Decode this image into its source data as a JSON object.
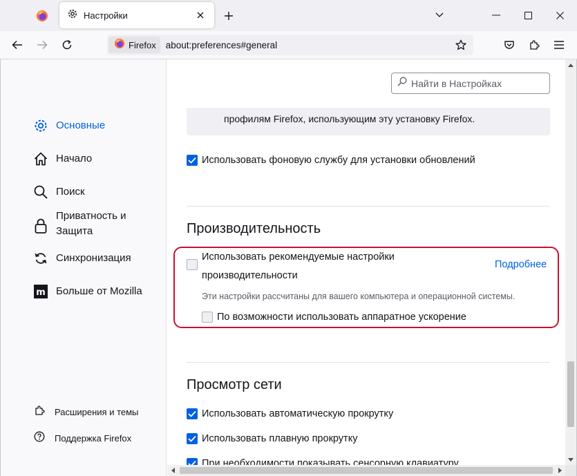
{
  "tab": {
    "title": "Настройки"
  },
  "urlbar": {
    "identity_label": "Firefox",
    "url": "about:preferences#general"
  },
  "search": {
    "placeholder": "Найти в Настройках"
  },
  "sidebar": {
    "categories": [
      {
        "label": "Основные",
        "icon": "gear-icon",
        "selected": true
      },
      {
        "label": "Начало",
        "icon": "home-icon"
      },
      {
        "label": "Поиск",
        "icon": "search-icon"
      },
      {
        "label": "Приватность и Защита",
        "icon": "lock-icon"
      },
      {
        "label": "Синхронизация",
        "icon": "sync-icon"
      },
      {
        "label": "Больше от Mozilla",
        "icon": "mozilla-icon"
      }
    ],
    "extensions_label": "Расширения и темы",
    "support_label": "Поддержка Firefox"
  },
  "main": {
    "profiles_text": "профилям Firefox, использующим эту установку Firefox.",
    "background_service_label": "Использовать фоновую службу для установки обновлений",
    "performance": {
      "heading": "Производительность",
      "recommended_line1": "Использовать рекомендуемые настройки",
      "recommended_line2": "производительности",
      "learn_more": "Подробнее",
      "description": "Эти настройки рассчитаны для вашего компьютера и операционной системы.",
      "hw_accel_label": "По возможности использовать аппаратное ускорение"
    },
    "browsing": {
      "heading": "Просмотр сети",
      "autoscroll_label": "Использовать автоматическую прокрутку",
      "smoothscroll_label": "Использовать плавную прокрутку",
      "cut_label": "При необходимости показывать сенсорную клавиатуру"
    }
  },
  "colors": {
    "accent": "#0061e0",
    "highlight": "#c8102e"
  }
}
